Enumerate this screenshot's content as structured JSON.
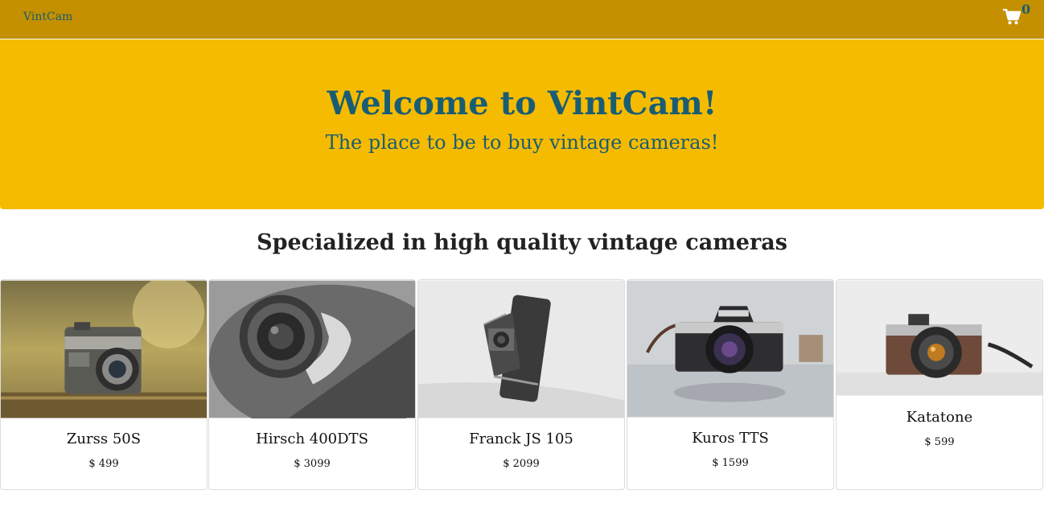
{
  "navbar": {
    "brand": "VintCam",
    "cart_count": "0"
  },
  "hero": {
    "title": "Welcome to VintCam!",
    "subtitle": "The place to be to buy vintage cameras!"
  },
  "section": {
    "title": "Specialized in high quality vintage cameras"
  },
  "products": [
    {
      "name": "Zurss 50S",
      "price": "$ 499",
      "icon": "camera-photo"
    },
    {
      "name": "Hirsch 400DTS",
      "price": "$ 3099",
      "icon": "camera-lens-photo"
    },
    {
      "name": "Franck JS 105",
      "price": "$ 2099",
      "icon": "folding-camera-photo"
    },
    {
      "name": "Kuros TTS",
      "price": "$ 1599",
      "icon": "slr-camera-photo"
    },
    {
      "name": "Katatone",
      "price": "$ 599",
      "icon": "rangefinder-camera-photo"
    }
  ],
  "colors": {
    "navbar": "#c49000",
    "hero": "#f5bb00",
    "accent": "#195d73"
  }
}
